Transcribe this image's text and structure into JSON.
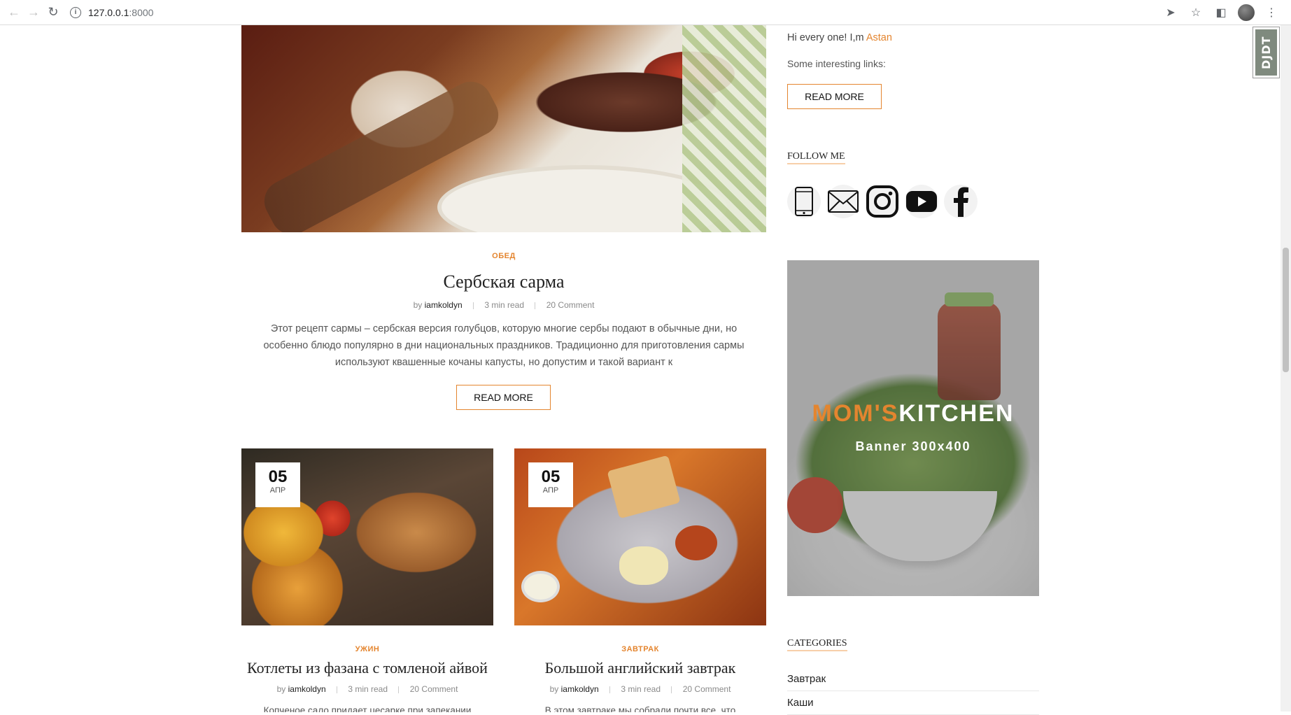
{
  "browser": {
    "url_host": "127.0.0.1",
    "url_port": ":8000"
  },
  "djdt_label": "DJDT",
  "featured_post": {
    "category": "ОБЕД",
    "title": "Сербская сарма",
    "by": "by",
    "author": "iamkoldyn",
    "read_time": "3 min read",
    "comments": "20 Comment",
    "excerpt": "Этот рецепт сармы – сербская версия голубцов, которую многие сербы подают в обычные дни, но особенно блюдо популярно в дни национальных праздников. Традиционно для приготовления сармы используют квашенные кочаны капусты, но допустим и такой вариант к",
    "button": "READ MORE"
  },
  "cards": [
    {
      "day": "05",
      "month": "АПР",
      "category": "УЖИН",
      "title": "Котлеты из фазана с томленой айвой",
      "by": "by",
      "author": "iamkoldyn",
      "read_time": "3 min read",
      "comments": "20 Comment",
      "excerpt": "Копченое сало придает цесарке при запекании"
    },
    {
      "day": "05",
      "month": "АПР",
      "category": "ЗАВТРАК",
      "title": "Большой английский завтрак",
      "by": "by",
      "author": "iamkoldyn",
      "read_time": "3 min read",
      "comments": "20 Comment",
      "excerpt": "В этом завтраке мы собрали почти все, что"
    }
  ],
  "sidebar": {
    "greeting": "Hi every one! I,m",
    "greeting_name": "Astan",
    "links_label": "Some interesting links:",
    "button": "READ MORE",
    "follow_title": "FOLLOW ME",
    "socials": [
      "phone-icon",
      "mail-icon",
      "instagram-icon",
      "youtube-icon",
      "facebook-icon"
    ],
    "banner": {
      "logo_m": "M",
      "logo_rest_orange": "OM'S",
      "logo_rest": "KITCHEN",
      "subtitle": "Banner 300x400"
    },
    "categories_title": "CATEGORIES",
    "categories": [
      "Завтрак",
      "Каши"
    ]
  },
  "colors": {
    "accent": "#e4852f"
  }
}
